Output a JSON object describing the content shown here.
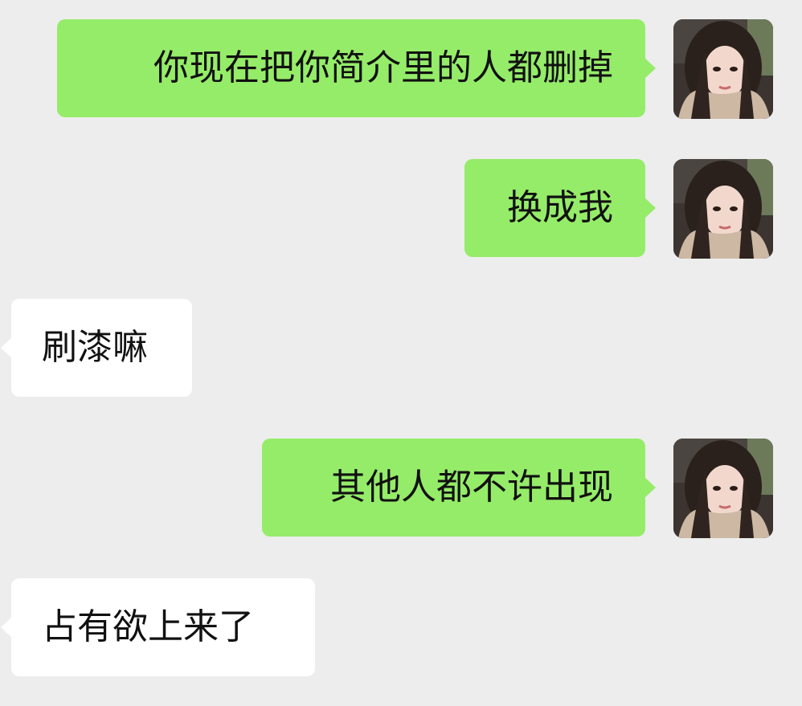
{
  "chat": {
    "messages": [
      {
        "sender": "self",
        "text": "你现在把你简介里的人都删掉"
      },
      {
        "sender": "self",
        "text": "换成我"
      },
      {
        "sender": "other",
        "text": "刷漆嘛"
      },
      {
        "sender": "self",
        "text": "其他人都不许出现"
      },
      {
        "sender": "other",
        "text": "占有欲上来了"
      }
    ]
  },
  "colors": {
    "background": "#ededed",
    "sent_bubble": "#95ec69",
    "received_bubble": "#ffffff",
    "text": "#111111"
  },
  "icons": {
    "self_avatar": "user-avatar-photo"
  }
}
